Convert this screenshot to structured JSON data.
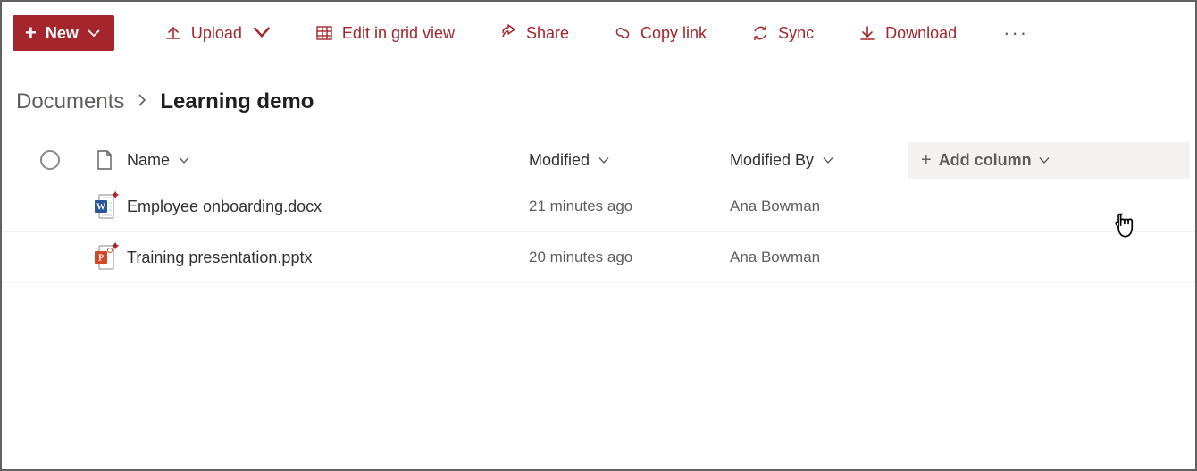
{
  "toolbar": {
    "new_label": "New",
    "upload_label": "Upload",
    "edit_grid_label": "Edit in grid view",
    "share_label": "Share",
    "copy_link_label": "Copy link",
    "sync_label": "Sync",
    "download_label": "Download"
  },
  "breadcrumb": {
    "root": "Documents",
    "current": "Learning demo"
  },
  "columns": {
    "name": "Name",
    "modified": "Modified",
    "modified_by": "Modified By",
    "add_column": "Add column"
  },
  "rows": [
    {
      "icon": "word",
      "name": "Employee onboarding.docx",
      "modified": "21 minutes ago",
      "modified_by": "Ana Bowman",
      "is_new": true
    },
    {
      "icon": "powerpoint",
      "name": "Training presentation.pptx",
      "modified": "20 minutes ago",
      "modified_by": "Ana Bowman",
      "is_new": true
    }
  ]
}
